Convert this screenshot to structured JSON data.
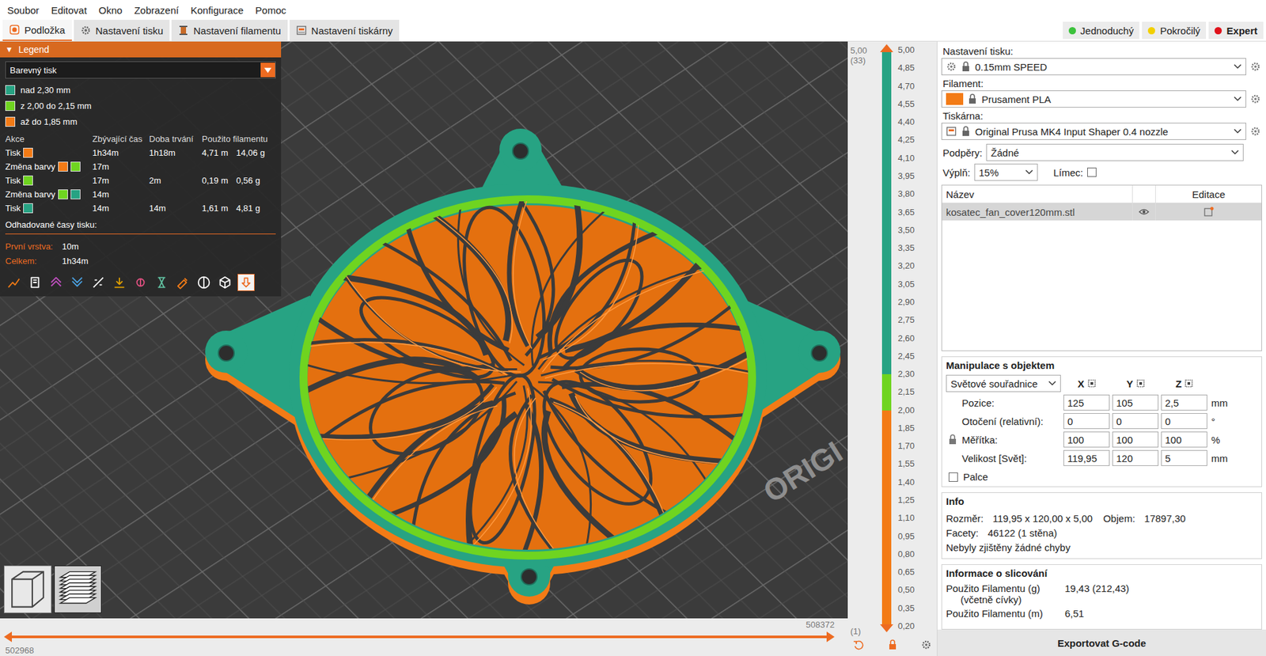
{
  "window": {
    "title": "PrusaSlicer"
  },
  "menu": [
    "Soubor",
    "Editovat",
    "Okno",
    "Zobrazení",
    "Konfigurace",
    "Pomoc"
  ],
  "tabs": [
    {
      "label": "Podložka",
      "selected": true
    },
    {
      "label": "Nastavení tisku",
      "selected": false
    },
    {
      "label": "Nastavení filamentu",
      "selected": false
    },
    {
      "label": "Nastavení tiskárny",
      "selected": false
    }
  ],
  "modes": [
    {
      "label": "Jednoduchý",
      "color": "#3cc23c",
      "selected": false
    },
    {
      "label": "Pokročilý",
      "color": "#f2d000",
      "selected": false
    },
    {
      "label": "Expert",
      "color": "#e0121b",
      "selected": true
    }
  ],
  "legend": {
    "toggle": "▼",
    "title": "Legend",
    "expanded": true,
    "view_type": "Barevný tisk",
    "ranges": [
      {
        "label": "nad 2,30 mm",
        "color": "#27a383"
      },
      {
        "label": "z 2,00 do 2,15 mm",
        "color": "#6fd420"
      },
      {
        "label": "až do 1,85 mm",
        "color": "#f37b16"
      }
    ],
    "columns": [
      "Akce",
      "Zbývající čas",
      "Doba trvání",
      "Použito filamentu"
    ],
    "rows": [
      {
        "action": "Tisk",
        "colors": [
          "#f37b16"
        ],
        "remaining": "1h34m",
        "duration": "1h18m",
        "length": "4,71 m",
        "weight": "14,06 g"
      },
      {
        "action": "Změna barvy",
        "colors": [
          "#f37b16",
          "#6fd420"
        ],
        "remaining": "17m",
        "duration": "",
        "length": "",
        "weight": ""
      },
      {
        "action": "Tisk",
        "colors": [
          "#6fd420"
        ],
        "remaining": "17m",
        "duration": "2m",
        "length": "0,19 m",
        "weight": "0,56 g"
      },
      {
        "action": "Změna barvy",
        "colors": [
          "#6fd420",
          "#27a383"
        ],
        "remaining": "14m",
        "duration": "",
        "length": "",
        "weight": ""
      },
      {
        "action": "Tisk",
        "colors": [
          "#27a383"
        ],
        "remaining": "14m",
        "duration": "14m",
        "length": "1,61 m",
        "weight": "4,81 g"
      }
    ],
    "estimates_title": "Odhadované časy tisku:",
    "estimates": [
      {
        "label": "První vrstva:",
        "value": "10m"
      },
      {
        "label": "Celkem:",
        "value": "1h34m"
      }
    ],
    "toolbar": [
      {
        "selected": false
      },
      {
        "selected": false
      },
      {
        "selected": false
      },
      {
        "selected": false
      },
      {
        "selected": false
      },
      {
        "selected": false
      },
      {
        "selected": false
      },
      {
        "selected": false
      },
      {
        "selected": false
      },
      {
        "selected": false
      },
      {
        "selected": false
      },
      {
        "selected": true
      }
    ]
  },
  "canvas": {
    "bed_logo": "ORIGI"
  },
  "view_toggle": [
    {
      "selected": false
    },
    {
      "selected": true
    }
  ],
  "vertical_slider": {
    "top_value": "5,00",
    "top_layer": "(33)",
    "bottom_layer": "(1)",
    "upper_level": 1,
    "lower_level": 0,
    "ticks": [
      "5,00",
      "4,85",
      "4,70",
      "4,55",
      "4,40",
      "4,25",
      "4,10",
      "3,95",
      "3,80",
      "3,65",
      "3,50",
      "3,35",
      "3,20",
      "3,05",
      "2,90",
      "2,75",
      "2,60",
      "2,45",
      "2,30",
      "2,15",
      "2,00",
      "1,85",
      "1,70",
      "1,55",
      "1,40",
      "1,25",
      "1,10",
      "0,95",
      "0,80",
      "0,65",
      "0,50",
      "0,35",
      "0,20"
    ],
    "segments": [
      {
        "color": "#27a383",
        "level": 0.5625
      },
      {
        "color": "#6fd420",
        "level": 0.0625
      },
      {
        "color": "#f37b16",
        "level": 0.375
      }
    ]
  },
  "horizontal_slider": {
    "upper": "508372",
    "lower": "502968",
    "upper_level": 1,
    "lower_level": 0
  },
  "sidebar": {
    "print_settings": {
      "label": "Nastavení tisku:",
      "value": "0.15mm SPEED",
      "locked": true
    },
    "filament": {
      "label": "Filament:",
      "value": "Prusament PLA",
      "color": "#f37b16",
      "locked": true
    },
    "printer": {
      "label": "Tiskárna:",
      "value": "Original Prusa MK4 Input Shaper 0.4 nozzle",
      "locked": true
    },
    "supports": {
      "label": "Podpěry:",
      "value": "Žádné"
    },
    "infill": {
      "label": "Výplň:",
      "value": "15%"
    },
    "brim": {
      "label": "Límec:",
      "checked": false
    },
    "object_list": {
      "columns": [
        "Název",
        "Editace"
      ],
      "rows": [
        {
          "name": "kosatec_fan_cover120mm.stl",
          "selected": true,
          "visible": true
        }
      ]
    },
    "manipulation": {
      "title": "Manipulace s objektem",
      "coord_system": "Světové souřadnice",
      "axes": [
        "X",
        "Y",
        "Z"
      ],
      "rows": [
        {
          "label": "Pozice:",
          "values": [
            "125",
            "105",
            "2,5"
          ],
          "unit": "mm",
          "locked": false
        },
        {
          "label": "Otočení (relativní):",
          "values": [
            "0",
            "0",
            "0"
          ],
          "unit": "°",
          "locked": false
        },
        {
          "label": "Měřítka:",
          "values": [
            "100",
            "100",
            "100"
          ],
          "unit": "%",
          "locked": true
        },
        {
          "label": "Velikost [Svět]:",
          "values": [
            "119,95",
            "120",
            "5"
          ],
          "unit": "mm",
          "locked": false
        }
      ],
      "inches": {
        "label": "Palce",
        "checked": false
      }
    },
    "info": {
      "title": "Info",
      "size_label": "Rozměr:",
      "size": "119,95 x 120,00 x 5,00",
      "volume_label": "Objem:",
      "volume": "17897,30",
      "facets_label": "Facety:",
      "facets": "46122 (1 stěna)",
      "message": "Nebyly zjištěny žádné chyby"
    },
    "slicing": {
      "title": "Informace o slicování",
      "rows": [
        {
          "label": "Použito Filamentu (g)",
          "sublabel": "(včetně cívky)",
          "value": "19,43 (212,43)"
        },
        {
          "label": "Použito Filamentu (m)",
          "value": "6,51"
        }
      ]
    },
    "export_button": "Exportovat G-code"
  }
}
